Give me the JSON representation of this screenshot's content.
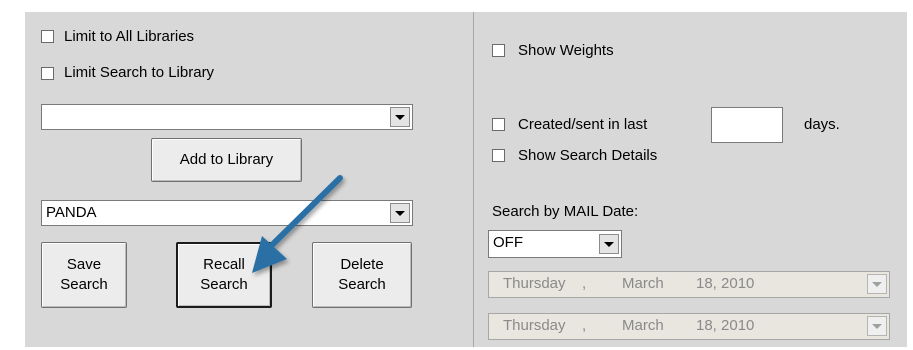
{
  "left": {
    "limit_all_libraries": {
      "label": "Limit to All Libraries",
      "checked": false
    },
    "limit_search_library": {
      "label": "Limit Search to Library",
      "checked": false
    },
    "library_select": {
      "value": ""
    },
    "add_to_library_label": "Add to Library",
    "saved_search_select": {
      "value": "PANDA"
    },
    "save_search": {
      "line1": "Save",
      "line2": "Search"
    },
    "recall_search": {
      "line1": "Recall",
      "line2": "Search"
    },
    "delete_search": {
      "line1": "Delete",
      "line2": "Search"
    }
  },
  "right": {
    "show_weights": {
      "label": "Show Weights",
      "checked": false
    },
    "created_sent": {
      "label": "Created/sent in last",
      "days_value": "",
      "suffix": "days."
    },
    "show_search_details": {
      "label": "Show Search Details",
      "checked": false
    },
    "mail_date_label": "Search by MAIL Date:",
    "mail_date_mode": {
      "value": "OFF"
    },
    "date_from": {
      "weekday": "Thursday",
      "sep": ",",
      "month": "March",
      "day_year": "18, 2010"
    },
    "date_to": {
      "weekday": "Thursday",
      "sep": ",",
      "month": "March",
      "day_year": "18, 2010"
    }
  },
  "colors": {
    "panel_bg": "#d8d8d8",
    "annotation_arrow": "#2a6fa5"
  }
}
